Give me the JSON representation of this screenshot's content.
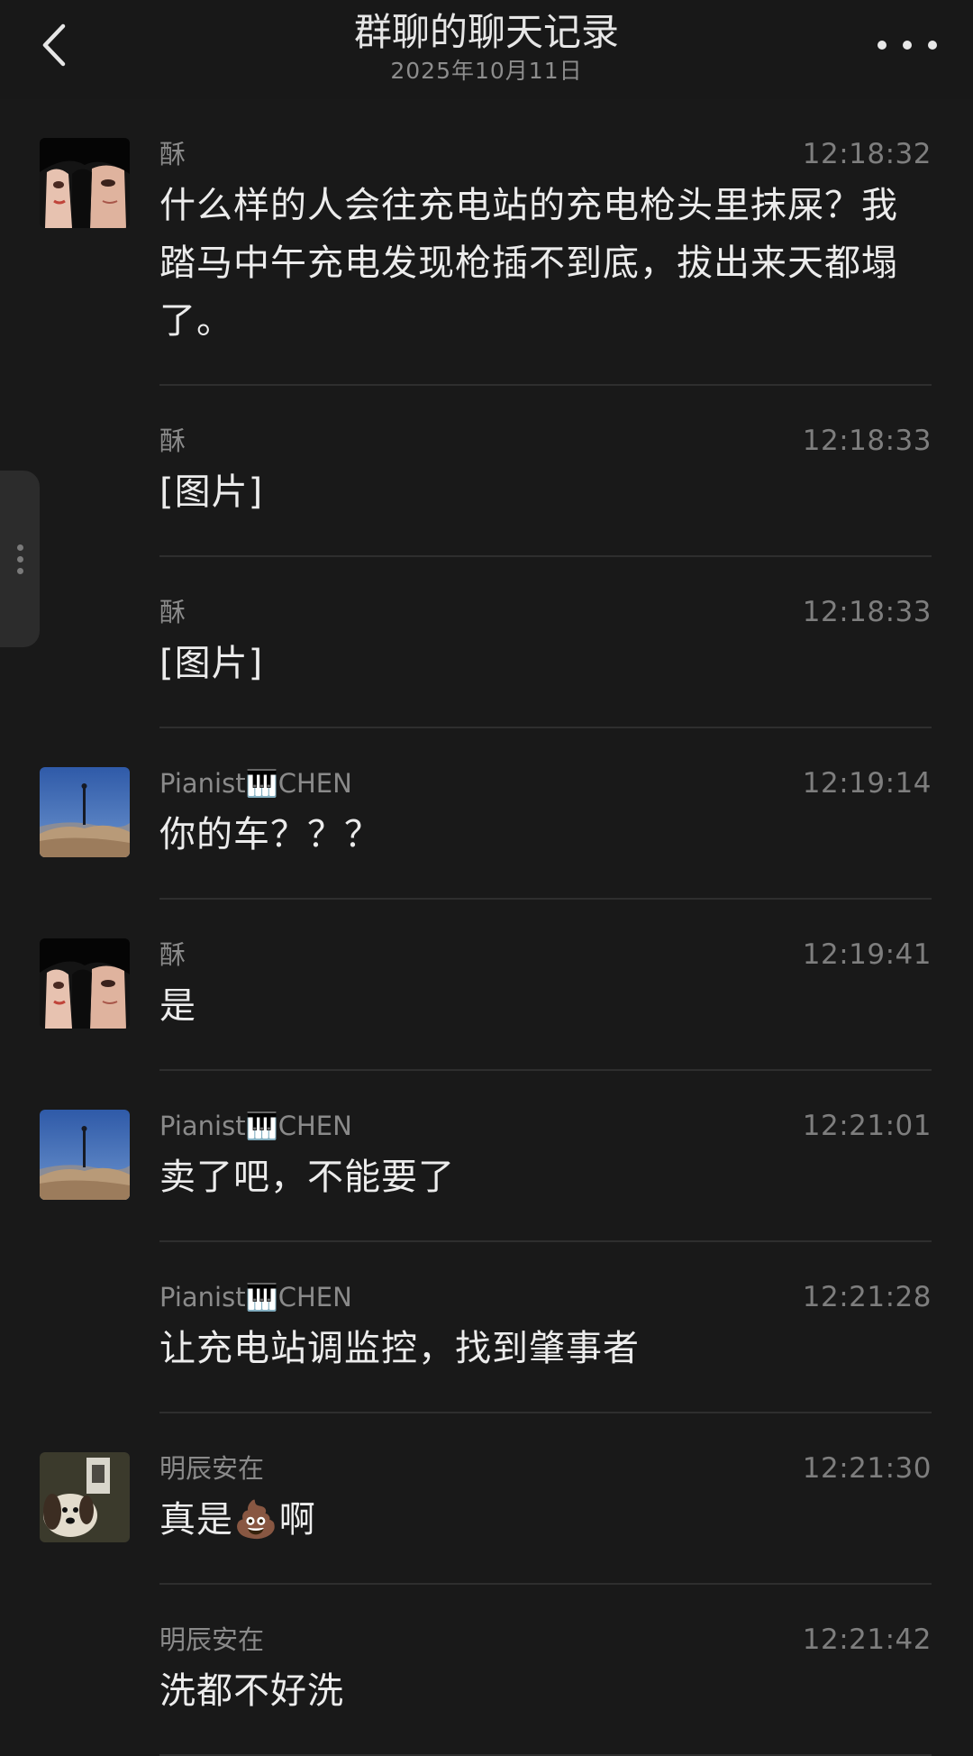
{
  "header": {
    "title": "群聊的聊天记录",
    "subtitle": "2025年10月11日"
  },
  "messages": [
    {
      "name": "酥",
      "time": "12:18:32",
      "text": "什么样的人会往充电站的充电枪头里抹屎？我踏马中午充电发现枪插不到底，拔出来天都塌了。",
      "avatar": "su"
    },
    {
      "name": "酥",
      "time": "12:18:33",
      "text": "[图片]",
      "avatar": ""
    },
    {
      "name": "酥",
      "time": "12:18:33",
      "text": "[图片]",
      "avatar": ""
    },
    {
      "name": "Pianist🎹CHEN",
      "time": "12:19:14",
      "text": "你的车？？？",
      "avatar": "chen"
    },
    {
      "name": "酥",
      "time": "12:19:41",
      "text": "是",
      "avatar": "su"
    },
    {
      "name": "Pianist🎹CHEN",
      "time": "12:21:01",
      "text": "卖了吧，不能要了",
      "avatar": "chen"
    },
    {
      "name": "Pianist🎹CHEN",
      "time": "12:21:28",
      "text": "让充电站调监控，找到肇事者",
      "avatar": ""
    },
    {
      "name": "明辰安在",
      "time": "12:21:30",
      "text": "真是💩啊",
      "avatar": "ming"
    },
    {
      "name": "明辰安在",
      "time": "12:21:42",
      "text": "洗都不好洗",
      "avatar": ""
    }
  ]
}
